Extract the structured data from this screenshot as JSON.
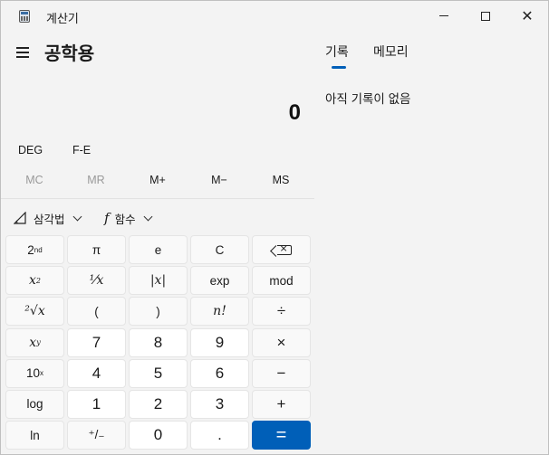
{
  "window": {
    "title": "계산기",
    "minimize": "—",
    "maximize": "□",
    "close": "✕"
  },
  "header": {
    "mode_title": "공학용"
  },
  "display": {
    "value": "0"
  },
  "toggles": {
    "angle": "DEG",
    "notation": "F-E"
  },
  "memory": {
    "buttons": [
      {
        "label": "MC",
        "enabled": false
      },
      {
        "label": "MR",
        "enabled": false
      },
      {
        "label": "M+",
        "enabled": true
      },
      {
        "label": "M−",
        "enabled": true
      },
      {
        "label": "MS",
        "enabled": true
      }
    ]
  },
  "functions": {
    "trig": {
      "icon": "triangle-ruler-icon",
      "label": "삼각법"
    },
    "func": {
      "icon": "function-f-icon",
      "glyph": "f",
      "label": "함수"
    }
  },
  "keypad": {
    "second": {
      "base": "2",
      "sup": "nd"
    },
    "pi": "π",
    "e": "e",
    "clear": "C",
    "backspace": "backspace-icon",
    "square": {
      "base": "x",
      "sup": "2"
    },
    "reciprocal": "¹⁄x",
    "abs": "|x|",
    "exp": "exp",
    "mod": "mod",
    "sqrt": "²√x",
    "lparen": "(",
    "rparen": ")",
    "factorial": "n!",
    "divide": "÷",
    "power": {
      "base": "x",
      "sup": "y"
    },
    "seven": "7",
    "eight": "8",
    "nine": "9",
    "multiply": "×",
    "tenpow": {
      "base": "10",
      "sup": "x"
    },
    "four": "4",
    "five": "5",
    "six": "6",
    "minus": "−",
    "log": "log",
    "one": "1",
    "two": "2",
    "three": "3",
    "plus": "+",
    "ln": "ln",
    "negate": "⁺/₋",
    "zero": "0",
    "decimal": ".",
    "equals": "="
  },
  "side_panel": {
    "tabs": [
      {
        "label": "기록",
        "active": true
      },
      {
        "label": "메모리",
        "active": false
      }
    ],
    "empty_message": "아직 기록이 없음"
  },
  "colors": {
    "accent": "#005fb8",
    "background": "#f3f3f3",
    "key_number": "#ffffff",
    "key_function": "#f9f9f9"
  }
}
